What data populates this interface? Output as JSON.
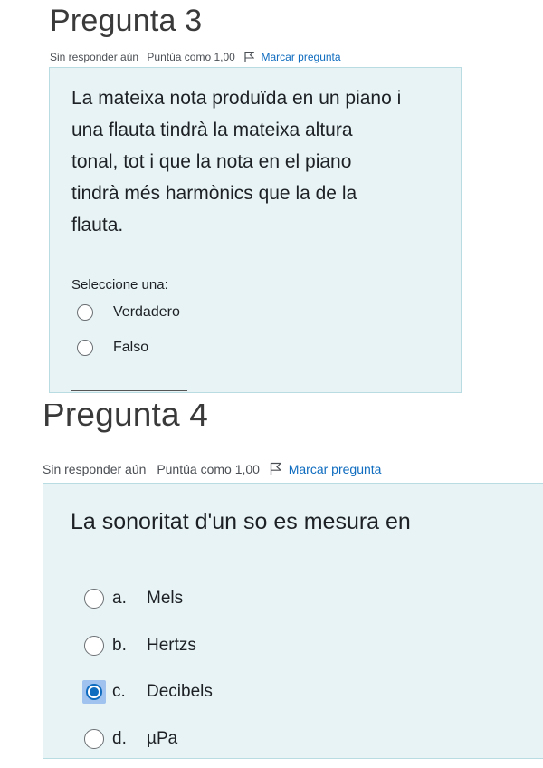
{
  "q3": {
    "title": "Pregunta 3",
    "status": "Sin responder aún",
    "score": "Puntúa como 1,00",
    "flag_label": "Marcar pregunta",
    "text_lines": [
      "La mateixa nota produïda en un piano i",
      "una flauta tindrà la mateixa altura",
      "tonal, tot i que la nota en el piano",
      "tindrà més harmònics que la de la",
      "flauta."
    ],
    "prompt": "Seleccione una:",
    "options": [
      {
        "label": "Verdadero",
        "selected": false
      },
      {
        "label": "Falso",
        "selected": false
      }
    ]
  },
  "q4": {
    "title": "Pregunta 4",
    "status": "Sin responder aún",
    "score": "Puntúa como 1,00",
    "flag_label": "Marcar pregunta",
    "text": "La sonoritat d'un so es mesura en",
    "options": [
      {
        "letter": "a.",
        "label": "Mels",
        "selected": false
      },
      {
        "letter": "b.",
        "label": "Hertzs",
        "selected": false
      },
      {
        "letter": "c.",
        "label": "Decibels",
        "selected": true
      },
      {
        "letter": "d.",
        "label": "µPa",
        "selected": false
      }
    ]
  },
  "colors": {
    "box_bg": "#e7f3f5",
    "link": "#0f6cbf",
    "selected_highlight": "#9fc2ef"
  },
  "icons": {
    "flag": "flag-icon",
    "radio": "radio-icon"
  }
}
